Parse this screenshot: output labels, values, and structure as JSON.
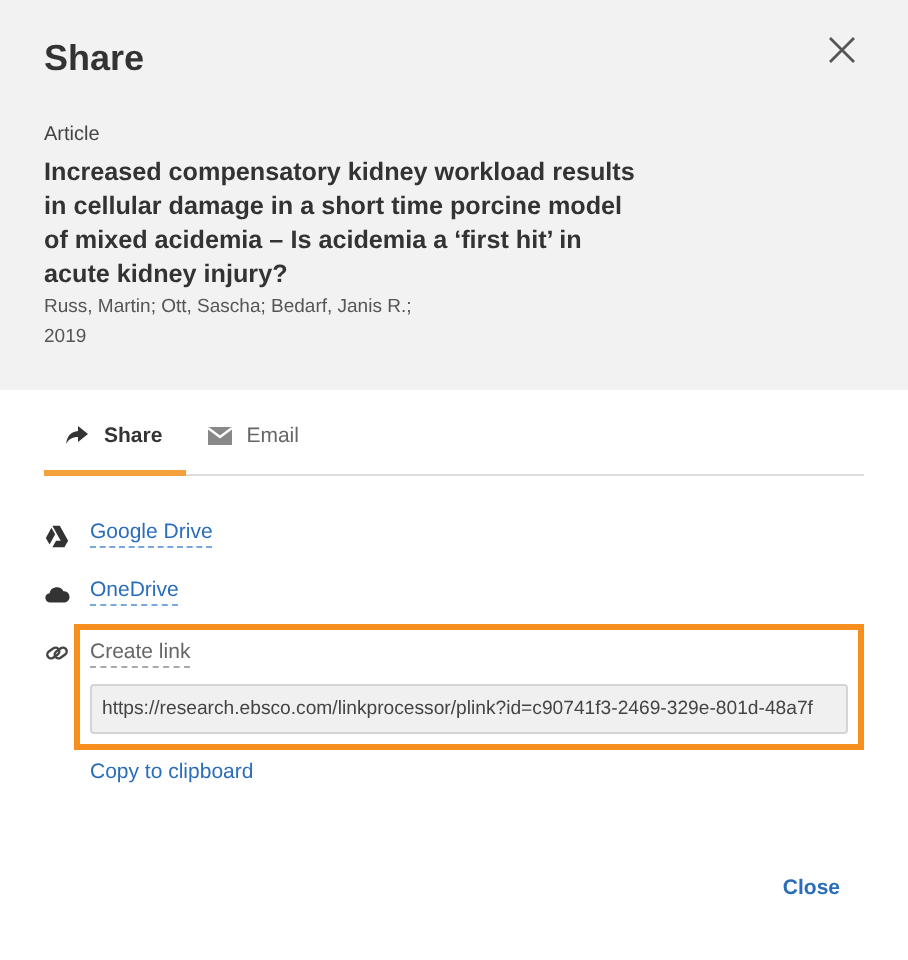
{
  "dialog": {
    "title": "Share"
  },
  "record": {
    "type": "Article",
    "title": "Increased compensatory kidney workload results in cellular damage in a short time porcine model of mixed acidemia – Is acidemia a ‘first hit’ in acute kidney injury?",
    "authors": "Russ, Martin; Ott, Sascha; Bedarf, Janis R.;",
    "year": "2019"
  },
  "tabs": [
    {
      "kind": "share",
      "label": "Share",
      "selected": true
    },
    {
      "kind": "email",
      "label": "Email",
      "selected": false
    }
  ],
  "options": [
    {
      "kind": "drive",
      "label": "Google Drive",
      "highlighted": false
    },
    {
      "kind": "cloud",
      "label": "OneDrive",
      "highlighted": false
    },
    {
      "kind": "link",
      "label": "Create link",
      "highlighted": true,
      "value": "https://research.ebsco.com/linkprocessor/plink?id=c90741f3-2469-329e-801d-48a7f"
    }
  ],
  "copy_link": "Copy to clipboard",
  "buttons": [
    {
      "label": "Close"
    }
  ]
}
